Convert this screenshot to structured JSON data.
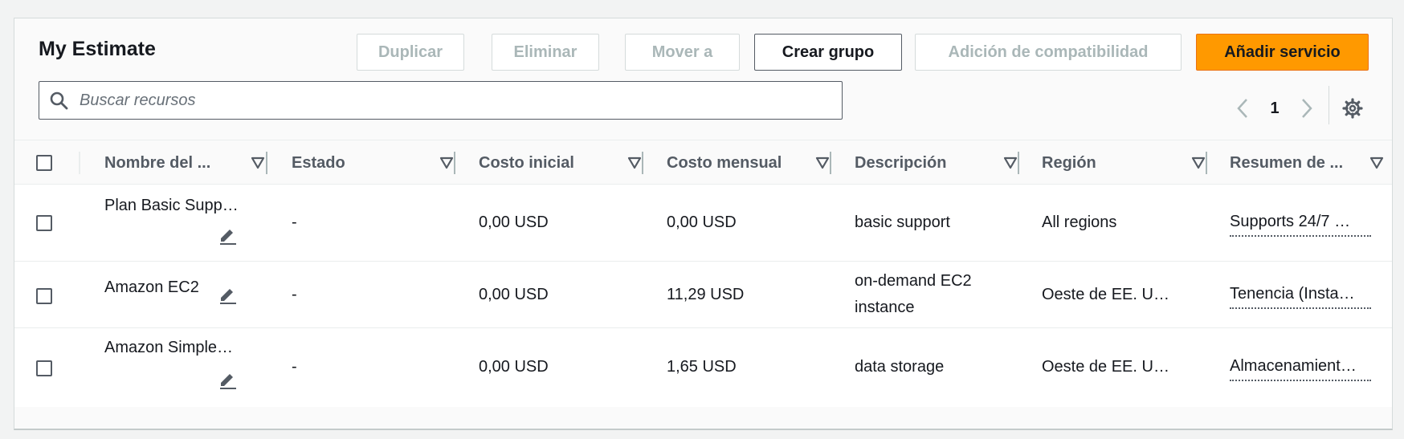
{
  "header": {
    "title": "My Estimate",
    "buttons": {
      "duplicate": "Duplicar",
      "delete": "Eliminar",
      "move": "Mover a",
      "create_group": "Crear grupo",
      "compat": "Adición de compatibilidad",
      "add_service": "Añadir servicio"
    }
  },
  "search": {
    "placeholder": "Buscar recursos",
    "value": ""
  },
  "pagination": {
    "current_page": "1"
  },
  "icons": {
    "search": "search-icon",
    "prev": "chevron-left-icon",
    "next": "chevron-right-icon",
    "settings": "gear-icon",
    "sort": "sort-triangle-icon",
    "edit": "pencil-icon"
  },
  "table": {
    "columns": [
      "Nombre del ...",
      "Estado",
      "Costo inicial",
      "Costo mensual",
      "Descripción",
      "Región",
      "Resumen de ..."
    ],
    "rows": [
      {
        "name": "Plan Basic Supp…",
        "status": "-",
        "upfront": "0,00 USD",
        "monthly": "0,00 USD",
        "description": "basic support",
        "region": "All regions",
        "summary": "Supports 24/7 …"
      },
      {
        "name": "Amazon EC2",
        "status": "-",
        "upfront": "0,00 USD",
        "monthly": "11,29 USD",
        "description": "on-demand EC2 instance",
        "region": "Oeste de EE. U…",
        "summary": "Tenencia (Insta…"
      },
      {
        "name": "Amazon Simple…",
        "status": "-",
        "upfront": "0,00 USD",
        "monthly": "1,65 USD",
        "description": "data storage",
        "region": "Oeste de EE. U…",
        "summary": "Almacenamient…"
      }
    ]
  },
  "colors": {
    "primary": "#ff9900",
    "disabled_text": "#aab7b8",
    "border": "#d5dbdb",
    "text": "#16191f"
  }
}
